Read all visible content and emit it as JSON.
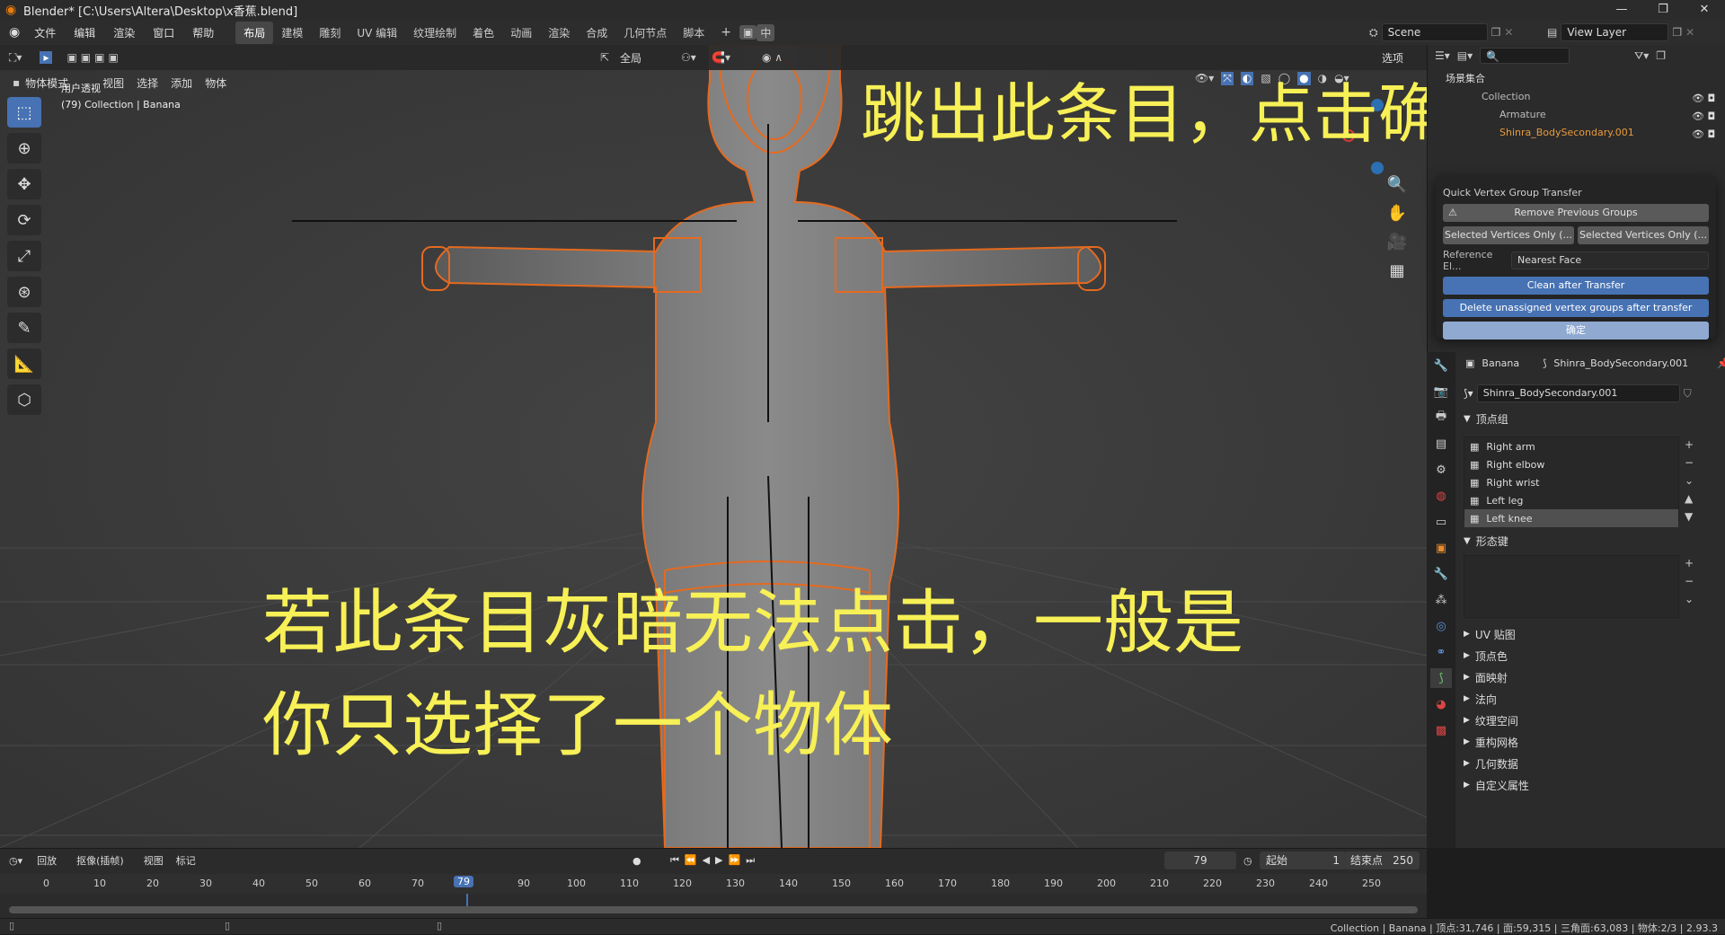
{
  "window": {
    "title": "Blender* [C:\\Users\\Altera\\Desktop\\x香蕉.blend]",
    "minimize": "—",
    "maximize": "❐",
    "close": "✕"
  },
  "menu": [
    "文件",
    "编辑",
    "渲染",
    "窗口",
    "帮助"
  ],
  "workspaces": [
    "布局",
    "建模",
    "雕刻",
    "UV 编辑",
    "纹理绘制",
    "着色",
    "动画",
    "渲染",
    "合成",
    "几何节点",
    "脚本"
  ],
  "workspace_active": 0,
  "scene": {
    "name": "Scene",
    "view_layer": "View Layer"
  },
  "viewport": {
    "mode": "物体模式",
    "menus": [
      "视图",
      "选择",
      "添加",
      "物体"
    ],
    "transform_orientation": "全局",
    "options": "选项",
    "view_name": "用户透视",
    "view_sub": "(79) Collection | Banana"
  },
  "annotations": {
    "top": "跳出此条目，点击确定",
    "bottom_line1": "若此条目灰暗无法点击，一般是",
    "bottom_line2": "你只选择了一个物体"
  },
  "outliner": {
    "search_placeholder": "",
    "header": "场景集合",
    "items": [
      "Collection",
      "Armature",
      "Shinra_BodySecondary.001"
    ]
  },
  "popup": {
    "title": "Quick Vertex Group Transfer",
    "remove_btn": "Remove Previous Groups",
    "sel_a": "Selected Vertices Only (...",
    "sel_b": "Selected Vertices Only (...",
    "ref_label": "Reference El...",
    "ref_value": "Nearest Face",
    "clean": "Clean after Transfer",
    "delete_unassigned": "Delete unassigned vertex groups after transfer",
    "ok": "确定"
  },
  "properties": {
    "object_name": "Banana",
    "mesh_name": "Shinra_BodySecondary.001",
    "mesh_field": "Shinra_BodySecondary.001",
    "vertex_groups_title": "顶点组",
    "vertex_groups": [
      "Right arm",
      "Right elbow",
      "Right wrist",
      "Left leg",
      "Left knee"
    ],
    "vertex_group_selected": 4,
    "shape_keys_title": "形态键",
    "panels": [
      "UV 贴图",
      "顶点色",
      "面映射",
      "法向",
      "纹理空间",
      "重构网格",
      "几何数据",
      "自定义属性"
    ]
  },
  "timeline": {
    "playback": "回放",
    "keying": "抠像(插帧)",
    "view": "视图",
    "marker": "标记",
    "current_frame": "79",
    "start_label": "起始",
    "start": "1",
    "end_label": "结束点",
    "end": "250",
    "ticks": [
      "0",
      "10",
      "20",
      "30",
      "40",
      "50",
      "60",
      "70",
      "79",
      "90",
      "100",
      "110",
      "120",
      "130",
      "140",
      "150",
      "160",
      "170",
      "180",
      "190",
      "200",
      "210",
      "220",
      "230",
      "240",
      "250"
    ]
  },
  "status": "Collection | Banana | 顶点:31,746 | 面:59,315 | 三角面:63,083 | 物体:2/3 | 2.93.3"
}
